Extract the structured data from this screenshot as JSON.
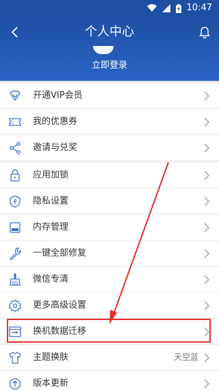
{
  "status_bar": {
    "time": "10:47"
  },
  "header": {
    "title": "个人中心",
    "login_label": "立即登录"
  },
  "group1": [
    {
      "label": "开通VIP会员",
      "icon": "diamond-icon"
    },
    {
      "label": "我的优惠券",
      "icon": "coupon-icon"
    },
    {
      "label": "邀请与兑奖",
      "icon": "share-icon"
    }
  ],
  "group2": [
    {
      "label": "应用加锁",
      "icon": "lock-icon"
    },
    {
      "label": "隐私设置",
      "icon": "shield-icon"
    },
    {
      "label": "内存管理",
      "icon": "memory-icon"
    },
    {
      "label": "一键全部修复",
      "icon": "wrench-icon"
    },
    {
      "label": "微信专清",
      "icon": "broom-icon"
    }
  ],
  "group3": [
    {
      "label": "更多高级设置",
      "icon": "gear-icon"
    },
    {
      "label": "换机数据迁移",
      "icon": "migrate-icon"
    },
    {
      "label": "主题换肤",
      "icon": "tshirt-icon",
      "value": "天空蓝"
    },
    {
      "label": "版本更新",
      "icon": "update-icon"
    }
  ],
  "colors": {
    "header": "#1f4fa3",
    "icon": "#3a6fc9",
    "highlight": "#e03030"
  }
}
